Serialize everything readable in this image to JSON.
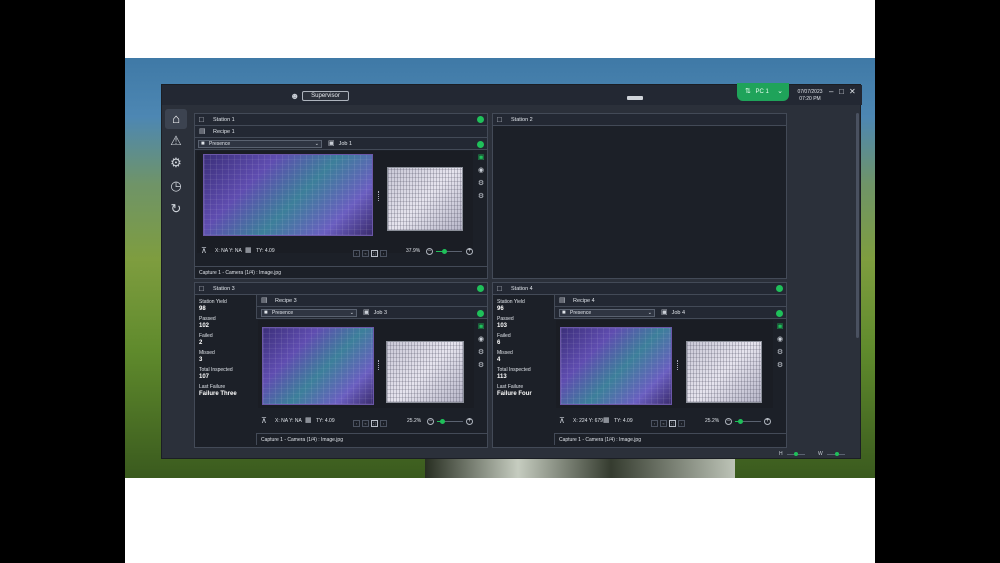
{
  "header": {
    "role_button": "Supervisor",
    "pc_label": "PC 1",
    "date": "07/07/2023",
    "time": "07:20 PM"
  },
  "icons": {
    "user": "user-icon",
    "network": "network-icon",
    "home": "home-icon",
    "alarm": "alarm-icon",
    "settings": "gear-icon",
    "history": "history-icon",
    "refresh": "refresh-icon",
    "monitor": "monitor-icon",
    "camera": "camera-icon"
  },
  "colors": {
    "ok": "#1fc05a",
    "pc_badge": "#1fa35a",
    "window_bg": "#2b303a",
    "panel_bg": "#1c2028"
  },
  "stations": [
    {
      "title": "Station 1",
      "recipe": "Recipe 1",
      "inspection": "Presence",
      "job": "Job 1",
      "coords": "X: NA Y: NA",
      "ty": "TY: 4.09",
      "zoom": "37.9%",
      "zoom_level": 0.3,
      "caption": "Capture 1 - Camera (1/4) : Image.jpg"
    },
    {
      "title": "Station 2"
    },
    {
      "title": "Station 3",
      "recipe": "Recipe 3",
      "inspection": "Presence",
      "job": "Job 3",
      "coords": "X: NA Y: NA",
      "ty": "TY: 4.09",
      "zoom": "25.2%",
      "zoom_level": 0.2,
      "caption": "Capture 1 - Camera (1/4) : Image.jpg",
      "stats": {
        "yield_label": "Station Yield",
        "yield": "98",
        "passed_label": "Passed",
        "passed": "102",
        "failed_label": "Failed",
        "failed": "2",
        "missed_label": "Missed",
        "missed": "3",
        "total_label": "Total Inspected",
        "total": "107",
        "last_label": "Last Failure",
        "last": "Failure Three"
      }
    },
    {
      "title": "Station 4",
      "recipe": "Recipe 4",
      "inspection": "Presence",
      "job": "Job 4",
      "coords": "X: 224 Y: 679",
      "ty": "TY: 4.09",
      "zoom": "25.2%",
      "zoom_level": 0.2,
      "caption": "Capture 1 - Camera (1/4) : Image.jpg",
      "stats": {
        "yield_label": "Station Yield",
        "yield": "96",
        "passed_label": "Passed",
        "passed": "103",
        "failed_label": "Failed",
        "failed": "6",
        "missed_label": "Missed",
        "missed": "4",
        "total_label": "Total Inspected",
        "total": "113",
        "last_label": "Last Failure",
        "last": "Failure Four"
      }
    }
  ],
  "footer": {
    "h_label": "H",
    "w_label": "W"
  }
}
